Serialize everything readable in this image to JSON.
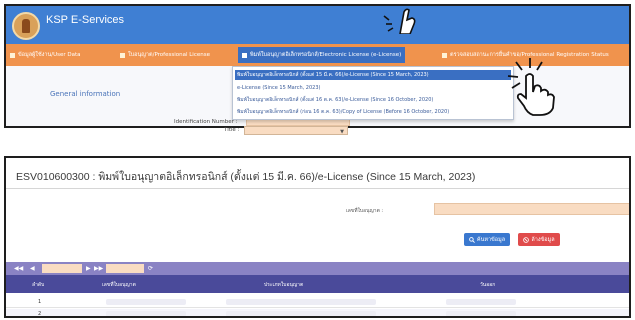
{
  "header": {
    "app_title": "KSP E-Services"
  },
  "nav": {
    "items": [
      {
        "label": "ข้อมูลผู้ใช้งาน/User Data"
      },
      {
        "label": "ใบอนุญาต/Professional License"
      },
      {
        "label": "พิมพ์ใบอนุญาตอิเล็กทรอนิกส์/Electronic License (e-License)"
      },
      {
        "label": "ตรวจสอบสถานะการยื่นคำขอ/Professional Registration Status"
      }
    ]
  },
  "dropdown": {
    "items": [
      "พิมพ์ใบอนุญาตอิเล็กทรอนิกส์ (ตั้งแต่ 15 มี.ค. 66)/e-License (Since 15 March, 2023)",
      "e-License (Since 15 March, 2023)",
      "พิมพ์ใบอนุญาตอิเล็กทรอนิกส์ (ตั้งแต่ 16 ต.ค. 63)/e-License (Since 16 October, 2020)",
      "พิมพ์ใบอนุญาตอิเล็กทรอนิกส์ (ก่อน 16 ต.ค. 63)/Copy of License (Before 16 October, 2020)"
    ]
  },
  "form": {
    "section_title": "General information",
    "uid_label": "Identification Number :",
    "title_label": "Title :",
    "title_arrow": "▼"
  },
  "page": {
    "heading": "ESV010600300 : พิมพ์ใบอนุญาตอิเล็กทรอนิกส์ (ตั้งแต่ 15 มี.ค. 66)/e-License (Since 15 March, 2023)",
    "search_label": "เลขที่ใบอนุญาต :",
    "search_button": "ค้นหาข้อมูล",
    "clear_button": "ล้างข้อมูล"
  },
  "pager": {
    "first": "◀◀",
    "prev": "◀",
    "next": "▶",
    "last": "▶▶",
    "refresh": "⟳"
  },
  "table": {
    "columns": [
      "ลำดับ",
      "เลขที่ใบอนุญาต",
      "ประเภทใบอนุญาต",
      "วันออก"
    ],
    "rows": [
      {
        "no": "1"
      },
      {
        "no": "2"
      }
    ]
  },
  "colors": {
    "topbar": "#3f7fd3",
    "navbar": "#f0934d",
    "nav_active": "#3a6fc2",
    "input_fill": "#f9dcc2",
    "pager": "#8a83c4",
    "table_header": "#4a4a9a",
    "search_button": "#3a78cf",
    "clear_button": "#e04b4b"
  },
  "icons": [
    "logo",
    "pointer-hand-icon",
    "search-icon",
    "clear-icon",
    "chevron-down-icon",
    "refresh-icon"
  ]
}
